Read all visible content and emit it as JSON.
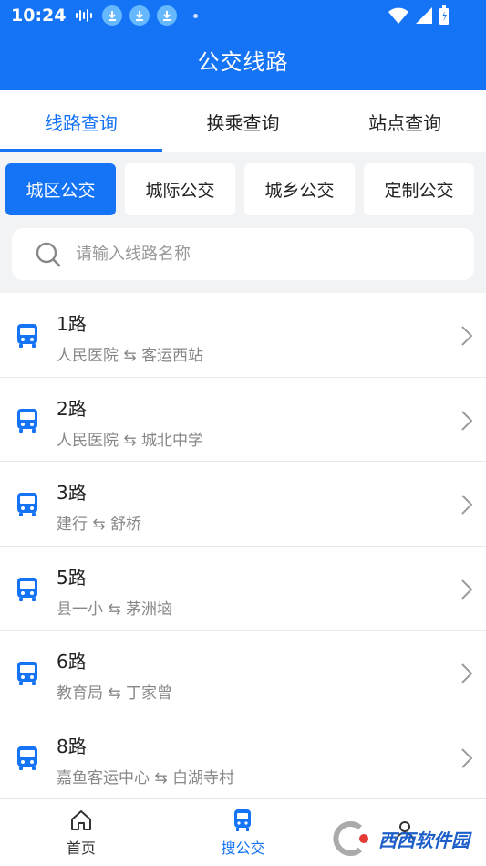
{
  "status_bar": {
    "time": "10:24"
  },
  "header": {
    "title": "公交线路"
  },
  "tabs": [
    {
      "label": "线路查询",
      "active": true
    },
    {
      "label": "换乘查询",
      "active": false
    },
    {
      "label": "站点查询",
      "active": false
    }
  ],
  "categories": [
    {
      "label": "城区公交",
      "active": true
    },
    {
      "label": "城际公交",
      "active": false
    },
    {
      "label": "城乡公交",
      "active": false
    },
    {
      "label": "定制公交",
      "active": false
    }
  ],
  "search": {
    "placeholder": "请输入线路名称",
    "value": ""
  },
  "routes": [
    {
      "name": "1路",
      "from": "人民医院",
      "to": "客运西站"
    },
    {
      "name": "2路",
      "from": "人民医院",
      "to": "城北中学"
    },
    {
      "name": "3路",
      "from": "建行",
      "to": "舒桥"
    },
    {
      "name": "5路",
      "from": "县一小",
      "to": "茅洲垴"
    },
    {
      "name": "6路",
      "from": "教育局",
      "to": "丁家曾"
    },
    {
      "name": "8路",
      "from": "嘉鱼客运中心",
      "to": "白湖寺村"
    }
  ],
  "direction_symbol": "⇆",
  "bottom_nav": [
    {
      "label": "首页",
      "icon": "home-icon",
      "active": false
    },
    {
      "label": "搜公交",
      "icon": "bus-icon",
      "active": true
    },
    {
      "label": "",
      "icon": "user-icon",
      "active": false
    }
  ],
  "watermark": {
    "text": "西西软件园"
  },
  "colors": {
    "accent": "#1573f5",
    "background": "#f2f3f5",
    "muted_text": "#888888"
  }
}
